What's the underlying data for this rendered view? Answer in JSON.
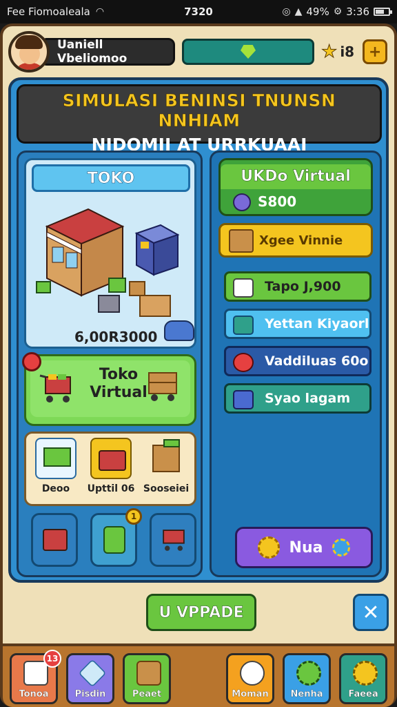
{
  "status_bar": {
    "carrier": "Fee Fiomoaleala",
    "time": "7320",
    "battery_text": "49%",
    "extra": "3:36"
  },
  "top_bar": {
    "player_name": "Uaniell Vbeliomoo",
    "stars": "i8",
    "plus_label": "+"
  },
  "title": {
    "line1": "SIMULASI BENINSI TNUNSN NNHIAM",
    "line2": "NIDOMII AT URRKUAAI"
  },
  "shop": {
    "header": "TOKO",
    "value": "6,00R3000"
  },
  "virtual_card": {
    "label": "Toko Virtual"
  },
  "mini_items": [
    {
      "label": "Deoo"
    },
    {
      "label": "Upttil 06"
    },
    {
      "label": "Sooseiei"
    }
  ],
  "bottom_icons": {
    "badge": "1"
  },
  "right_panel": {
    "green_title": "UKDo Virtual",
    "green_value": "S800",
    "yellow_label": "Xgee Vinnie",
    "rows": [
      {
        "label": "Tapo J,900",
        "color": "#6ac63f"
      },
      {
        "label": "Yettan Kiyaorl",
        "color": "#4fc0f0"
      },
      {
        "label": "Vaddiluas 60o",
        "color": "#2a5aa6"
      },
      {
        "label": "Syao lagam",
        "color": "#2fa08a"
      }
    ],
    "action_label": "Nua"
  },
  "upgrade_label": "U VPPADE",
  "close_label": "✕",
  "nav": [
    {
      "label": "Tonoa",
      "badge": "13",
      "color": "#e8794a"
    },
    {
      "label": "Pisdin",
      "color": "#8a7ae8"
    },
    {
      "label": "Peaet",
      "color": "#6ac63f"
    },
    {
      "label": "Moman",
      "color": "#f4a11f"
    },
    {
      "label": "Nenha",
      "color": "#3aa0e6"
    },
    {
      "label": "Faeea",
      "color": "#2fa08a"
    }
  ]
}
